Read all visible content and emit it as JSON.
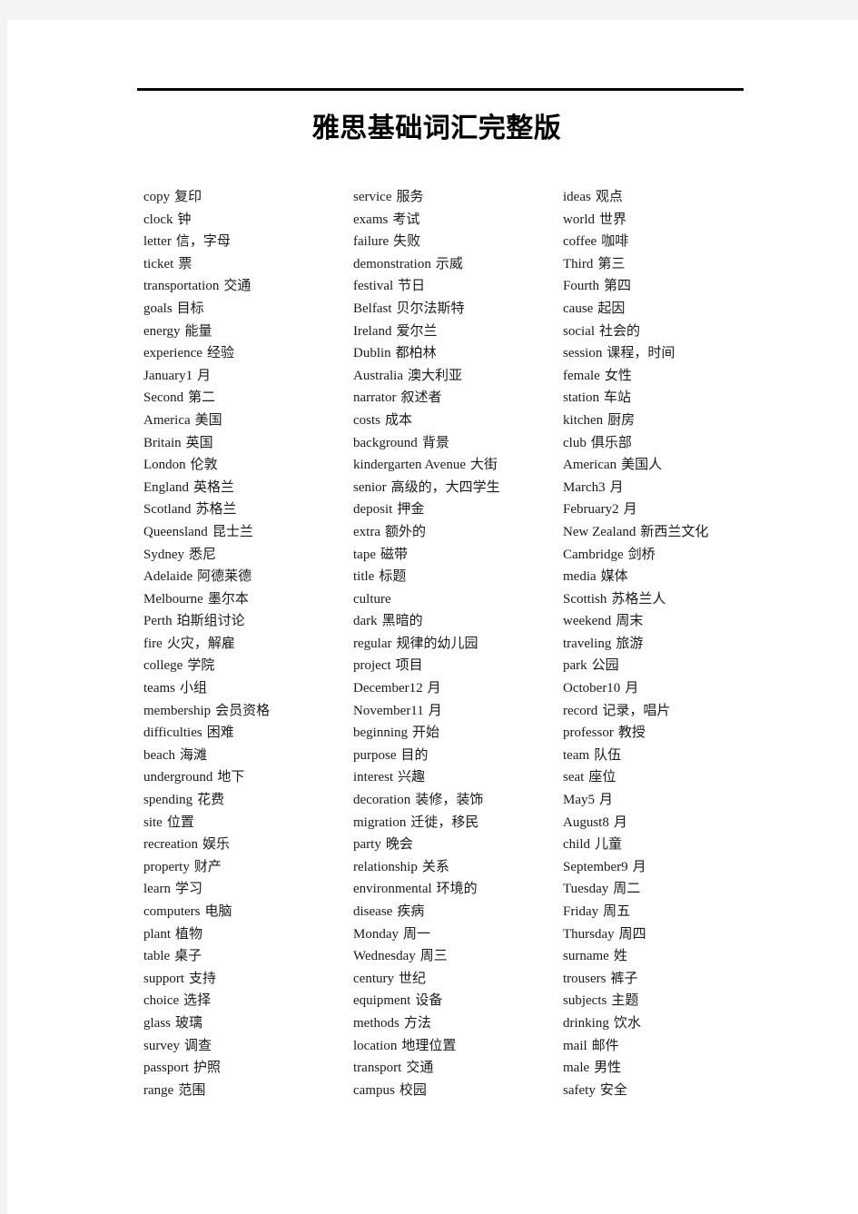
{
  "document": {
    "title": "雅思基础词汇完整版",
    "has_title_rule": true,
    "text_color": "#1a1a1a",
    "page_background": "#ffffff",
    "canvas_background": "#f4f4f4"
  },
  "columns": [
    {
      "name": "column-1",
      "entries": [
        {
          "term": "copy",
          "gloss": "复印"
        },
        {
          "term": "clock",
          "gloss": "钟"
        },
        {
          "term": "letter",
          "gloss": "信，字母"
        },
        {
          "term": "ticket",
          "gloss": "票"
        },
        {
          "term": "transportation",
          "gloss": "交通"
        },
        {
          "term": "goals",
          "gloss": "目标"
        },
        {
          "term": "energy",
          "gloss": "能量"
        },
        {
          "term": "experience",
          "gloss": "经验"
        },
        {
          "term": "January1",
          "gloss": "月"
        },
        {
          "term": "Second",
          "gloss": "第二"
        },
        {
          "term": "America",
          "gloss": "美国"
        },
        {
          "term": "Britain",
          "gloss": "英国"
        },
        {
          "term": "London",
          "gloss": "伦敦"
        },
        {
          "term": "England",
          "gloss": "英格兰"
        },
        {
          "term": "Scotland",
          "gloss": "苏格兰"
        },
        {
          "term": "Queensland",
          "gloss": "昆士兰"
        },
        {
          "term": "Sydney",
          "gloss": "悉尼"
        },
        {
          "term": "Adelaide",
          "gloss": "阿德莱德"
        },
        {
          "term": "Melbourne",
          "gloss": "墨尔本"
        },
        {
          "term": "Perth",
          "gloss": "珀斯组讨论"
        },
        {
          "term": "fire",
          "gloss": "火灾，解雇"
        },
        {
          "term": "college",
          "gloss": "学院"
        },
        {
          "term": "teams",
          "gloss": "小组"
        },
        {
          "term": "membership",
          "gloss": "会员资格"
        },
        {
          "term": "difficulties",
          "gloss": "困难"
        },
        {
          "term": "beach",
          "gloss": "海滩"
        },
        {
          "term": "underground",
          "gloss": "地下"
        },
        {
          "term": "spending",
          "gloss": "花费"
        },
        {
          "term": "site",
          "gloss": "位置"
        },
        {
          "term": "recreation",
          "gloss": "娱乐"
        },
        {
          "term": "property",
          "gloss": "财产"
        },
        {
          "term": "learn",
          "gloss": "学习"
        },
        {
          "term": "computers",
          "gloss": "电脑"
        },
        {
          "term": "plant",
          "gloss": "植物"
        },
        {
          "term": "table",
          "gloss": "桌子"
        },
        {
          "term": "support",
          "gloss": "支持"
        },
        {
          "term": "choice",
          "gloss": "选择"
        },
        {
          "term": "glass",
          "gloss": "玻璃"
        },
        {
          "term": "survey",
          "gloss": "调查"
        },
        {
          "term": "passport",
          "gloss": "护照"
        },
        {
          "term": "range",
          "gloss": "范围"
        }
      ]
    },
    {
      "name": "column-2",
      "entries": [
        {
          "term": "service",
          "gloss": "服务"
        },
        {
          "term": "exams",
          "gloss": "考试"
        },
        {
          "term": "failure",
          "gloss": "失败"
        },
        {
          "term": "demonstration",
          "gloss": "示威"
        },
        {
          "term": "festival",
          "gloss": "节日"
        },
        {
          "term": "Belfast",
          "gloss": "贝尔法斯特"
        },
        {
          "term": "Ireland",
          "gloss": "爱尔兰"
        },
        {
          "term": "Dublin",
          "gloss": "都柏林"
        },
        {
          "term": "Australia",
          "gloss": "澳大利亚"
        },
        {
          "term": "narrator",
          "gloss": "叙述者"
        },
        {
          "term": "costs",
          "gloss": "成本"
        },
        {
          "term": "background",
          "gloss": "背景"
        },
        {
          "term": "kindergarten Avenue",
          "gloss": "大街"
        },
        {
          "term": "senior",
          "gloss": "高级的，大四学生"
        },
        {
          "term": "deposit",
          "gloss": "押金"
        },
        {
          "term": "extra",
          "gloss": "额外的"
        },
        {
          "term": "tape",
          "gloss": "磁带"
        },
        {
          "term": "title",
          "gloss": "标题"
        },
        {
          "term": "culture",
          "gloss": ""
        },
        {
          "term": "dark",
          "gloss": "黑暗的"
        },
        {
          "term": "regular",
          "gloss": "规律的幼儿园"
        },
        {
          "term": "project",
          "gloss": "项目"
        },
        {
          "term": "December12",
          "gloss": "月"
        },
        {
          "term": "November11",
          "gloss": "月"
        },
        {
          "term": "beginning",
          "gloss": "开始"
        },
        {
          "term": "purpose",
          "gloss": "目的"
        },
        {
          "term": "interest",
          "gloss": "兴趣"
        },
        {
          "term": "decoration",
          "gloss": "装修，装饰"
        },
        {
          "term": "migration",
          "gloss": "迁徙，移民"
        },
        {
          "term": "party",
          "gloss": "晚会"
        },
        {
          "term": "relationship",
          "gloss": "关系"
        },
        {
          "term": "environmental",
          "gloss": "环境的"
        },
        {
          "term": "disease",
          "gloss": "疾病"
        },
        {
          "term": "Monday",
          "gloss": "周一"
        },
        {
          "term": "Wednesday",
          "gloss": "周三"
        },
        {
          "term": "century",
          "gloss": "世纪"
        },
        {
          "term": "equipment",
          "gloss": "设备"
        },
        {
          "term": "methods",
          "gloss": "方法"
        },
        {
          "term": "location",
          "gloss": "地理位置"
        },
        {
          "term": "transport",
          "gloss": "交通"
        },
        {
          "term": "campus",
          "gloss": "校园"
        }
      ]
    },
    {
      "name": "column-3",
      "entries": [
        {
          "term": "ideas",
          "gloss": "观点"
        },
        {
          "term": "world",
          "gloss": "世界"
        },
        {
          "term": "coffee",
          "gloss": "咖啡"
        },
        {
          "term": "Third",
          "gloss": "第三"
        },
        {
          "term": "Fourth",
          "gloss": "第四"
        },
        {
          "term": "cause",
          "gloss": "起因"
        },
        {
          "term": "social",
          "gloss": "社会的"
        },
        {
          "term": "session",
          "gloss": "课程，时间"
        },
        {
          "term": "female",
          "gloss": "女性"
        },
        {
          "term": "station",
          "gloss": "车站"
        },
        {
          "term": "kitchen",
          "gloss": "厨房"
        },
        {
          "term": "club",
          "gloss": "俱乐部"
        },
        {
          "term": "American",
          "gloss": "美国人"
        },
        {
          "term": "March3",
          "gloss": "月"
        },
        {
          "term": "February2",
          "gloss": "月"
        },
        {
          "term": "New Zealand",
          "gloss": "新西兰文化"
        },
        {
          "term": "Cambridge",
          "gloss": "剑桥"
        },
        {
          "term": "media",
          "gloss": "媒体"
        },
        {
          "term": "Scottish",
          "gloss": "苏格兰人"
        },
        {
          "term": "weekend",
          "gloss": "周末"
        },
        {
          "term": "traveling",
          "gloss": "旅游"
        },
        {
          "term": "park",
          "gloss": "公园"
        },
        {
          "term": "October10",
          "gloss": "月"
        },
        {
          "term": "record",
          "gloss": "记录，唱片"
        },
        {
          "term": "professor",
          "gloss": "教授"
        },
        {
          "term": "team",
          "gloss": "队伍"
        },
        {
          "term": "seat",
          "gloss": "座位"
        },
        {
          "term": "May5",
          "gloss": "月"
        },
        {
          "term": "August8",
          "gloss": "月"
        },
        {
          "term": "child",
          "gloss": "儿童"
        },
        {
          "term": "September9",
          "gloss": "月"
        },
        {
          "term": "Tuesday",
          "gloss": "周二"
        },
        {
          "term": "Friday",
          "gloss": "周五"
        },
        {
          "term": "Thursday",
          "gloss": "周四"
        },
        {
          "term": "surname",
          "gloss": "姓"
        },
        {
          "term": "trousers",
          "gloss": "裤子"
        },
        {
          "term": "subjects",
          "gloss": "主题"
        },
        {
          "term": "drinking",
          "gloss": "饮水"
        },
        {
          "term": "mail",
          "gloss": "邮件"
        },
        {
          "term": "male",
          "gloss": "男性"
        },
        {
          "term": "safety",
          "gloss": "安全"
        }
      ]
    }
  ]
}
